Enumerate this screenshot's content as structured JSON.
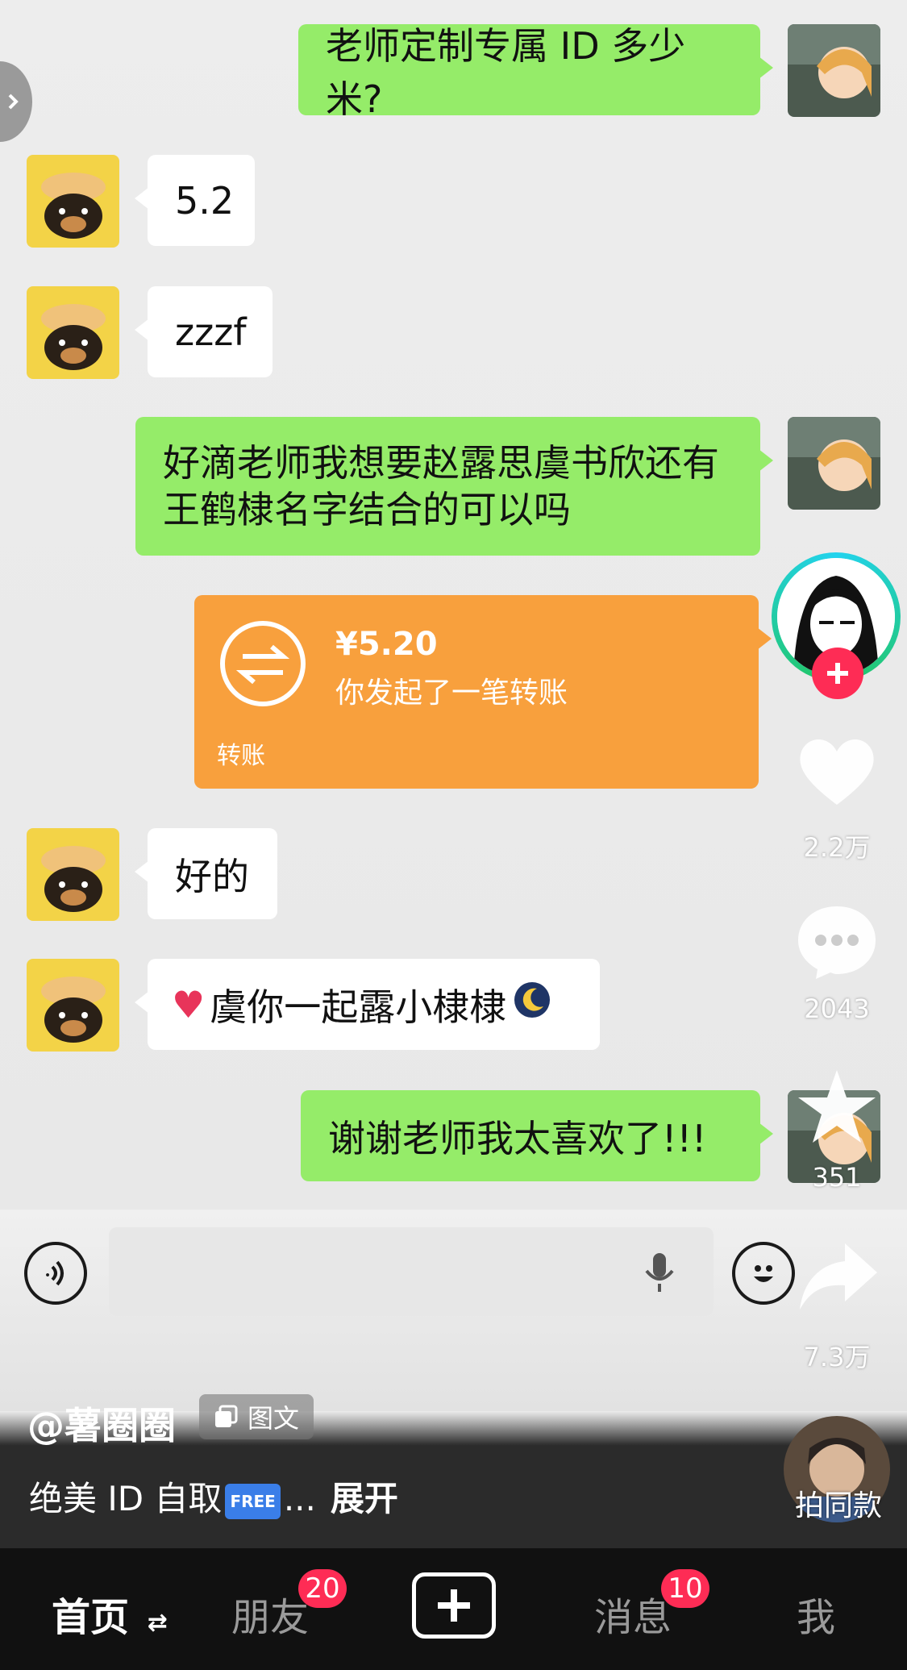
{
  "messages": [
    {
      "side": "right",
      "text": "老师定制专属 ID 多少米?"
    },
    {
      "side": "left",
      "text": "5.2"
    },
    {
      "side": "left",
      "text": "zzzf"
    },
    {
      "side": "right",
      "lines": [
        "好滴老师我想要赵露思虞书欣还有",
        "王鹤棣名字结合的可以吗"
      ]
    },
    {
      "side": "left",
      "text": "好的"
    },
    {
      "side": "left",
      "text": "虞你一起露小棣棣"
    },
    {
      "side": "right",
      "text": "谢谢老师我太喜欢了!!!"
    }
  ],
  "transfer": {
    "amount": "¥5.20",
    "description": "你发起了一笔转账",
    "label": "转账"
  },
  "side_actions": {
    "likes": "2.2万",
    "comments": "2043",
    "favorites": "351",
    "shares": "7.3万"
  },
  "post": {
    "handle": "@薯圈圈",
    "tag": "图文",
    "description": "绝美 ID 自取",
    "free_badge": "FREE",
    "ellipsis": "...",
    "expand": "展开"
  },
  "same_style_label": "拍同款",
  "nav": {
    "home": "首页",
    "friends": "朋友",
    "friends_badge": "20",
    "messages": "消息",
    "messages_badge": "10",
    "me": "我"
  },
  "colors": {
    "bubble_green": "#95ec69",
    "transfer_orange": "#f8a03d",
    "badge_red": "#fe2c55"
  }
}
